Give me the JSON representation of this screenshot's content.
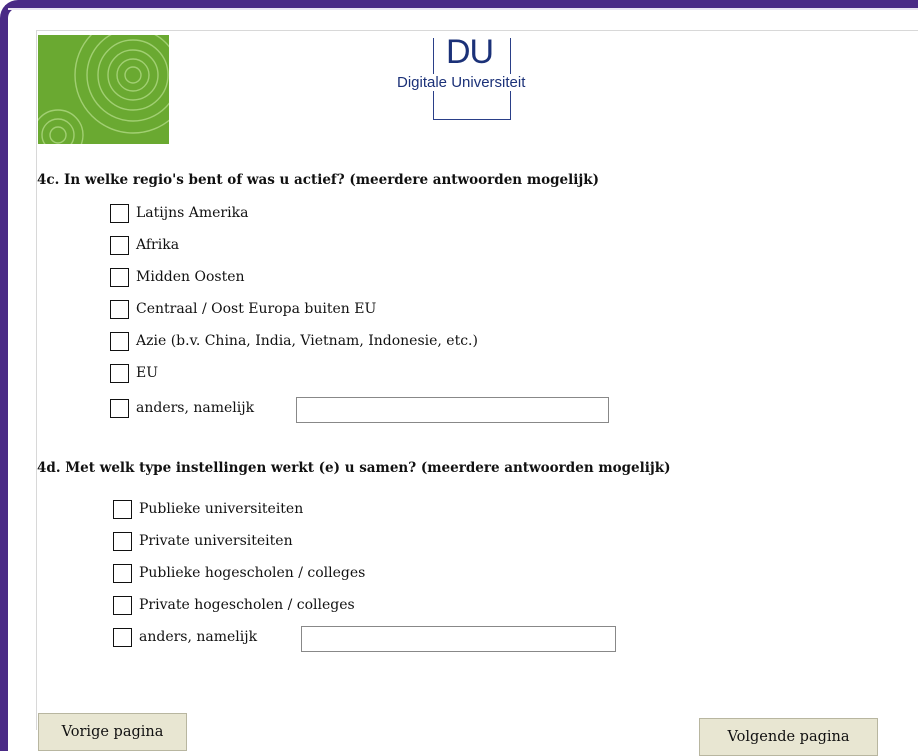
{
  "header": {
    "du_abbrev": "DU",
    "du_name": "Digitale Universiteit"
  },
  "q4c": {
    "title": "4c. In welke regio's bent of was u actief? (meerdere antwoorden mogelijk)",
    "options": [
      "Latijns Amerika",
      "Afrika",
      "Midden Oosten",
      "Centraal / Oost Europa buiten EU",
      "Azie (b.v. China, India, Vietnam, Indonesie, etc.)",
      "EU",
      "anders, namelijk"
    ],
    "other_value": ""
  },
  "q4d": {
    "title": "4d. Met welk type instellingen werkt (e) u samen? (meerdere antwoorden mogelijk)",
    "options": [
      "Publieke universiteiten",
      "Private universiteiten",
      "Publieke hogescholen /  colleges",
      "Private hogescholen / colleges",
      "anders, namelijk"
    ],
    "other_value": ""
  },
  "nav": {
    "prev_label": "Vorige pagina",
    "next_label": "Volgende pagina"
  }
}
